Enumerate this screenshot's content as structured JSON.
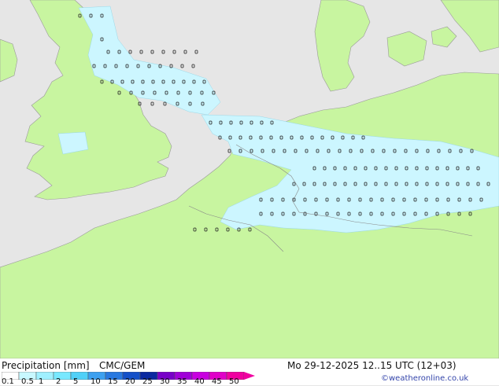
{
  "footer": {
    "title": "Precipitation [mm]",
    "model": "CMC/GEM",
    "datetime": "Mo 29-12-2025 12..15 UTC (12+03)",
    "credit": "©weatheronline.co.uk"
  },
  "legend": {
    "ticks": [
      "0.1",
      "0.5",
      "1",
      "2",
      "5",
      "10",
      "15",
      "20",
      "25",
      "30",
      "35",
      "40",
      "45",
      "50"
    ],
    "colors": [
      "#ffffff",
      "#c8f8ff",
      "#a0f0ff",
      "#78e8ff",
      "#50d0f8",
      "#3ca0f0",
      "#2878e0",
      "#1450c8",
      "#0a28a0",
      "#7800c8",
      "#a000d8",
      "#c800e0",
      "#e000c8",
      "#f000a0"
    ]
  },
  "colors": {
    "land": "#c8f5a0",
    "sea": "#e6e6e6",
    "precip_light": "#ccf6ff",
    "border": "#888888"
  }
}
